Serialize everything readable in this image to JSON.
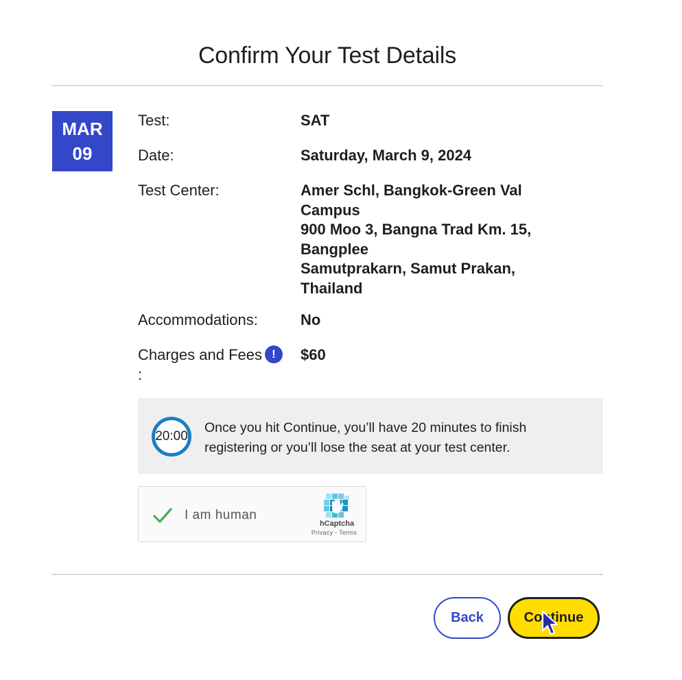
{
  "header": {
    "title": "Confirm Your Test Details"
  },
  "date_badge": {
    "month": "MAR",
    "day": "09",
    "color": "#3347c8"
  },
  "details": {
    "test_label": "Test:",
    "test_value": "SAT",
    "date_label": "Date:",
    "date_value": "Saturday, March 9, 2024",
    "center_label": "Test Center:",
    "center_lines": [
      "Amer Schl, Bangkok-Green Val",
      "Campus",
      "900 Moo 3, Bangna Trad Km. 15,",
      "Bangplee",
      "Samutprakarn, Samut Prakan,",
      "Thailand"
    ],
    "accommodations_label": "Accommodations:",
    "accommodations_value": "No",
    "fees_label": "Charges and Fees",
    "fees_label_suffix": ":",
    "fees_info_icon": "!",
    "fees_value": "$60"
  },
  "timer_notice": {
    "timer": "20:00",
    "message": "Once you hit Continue, you’ll have 20 minutes to finish registering or you’ll lose the seat at your test center.",
    "accent_color": "#1a7fc4"
  },
  "captcha": {
    "label": "I am human",
    "brand": "hCaptcha",
    "links": "Privacy - Terms",
    "checked": true
  },
  "actions": {
    "back_label": "Back",
    "continue_label": "Continue",
    "continue_color": "#ffdd00"
  }
}
